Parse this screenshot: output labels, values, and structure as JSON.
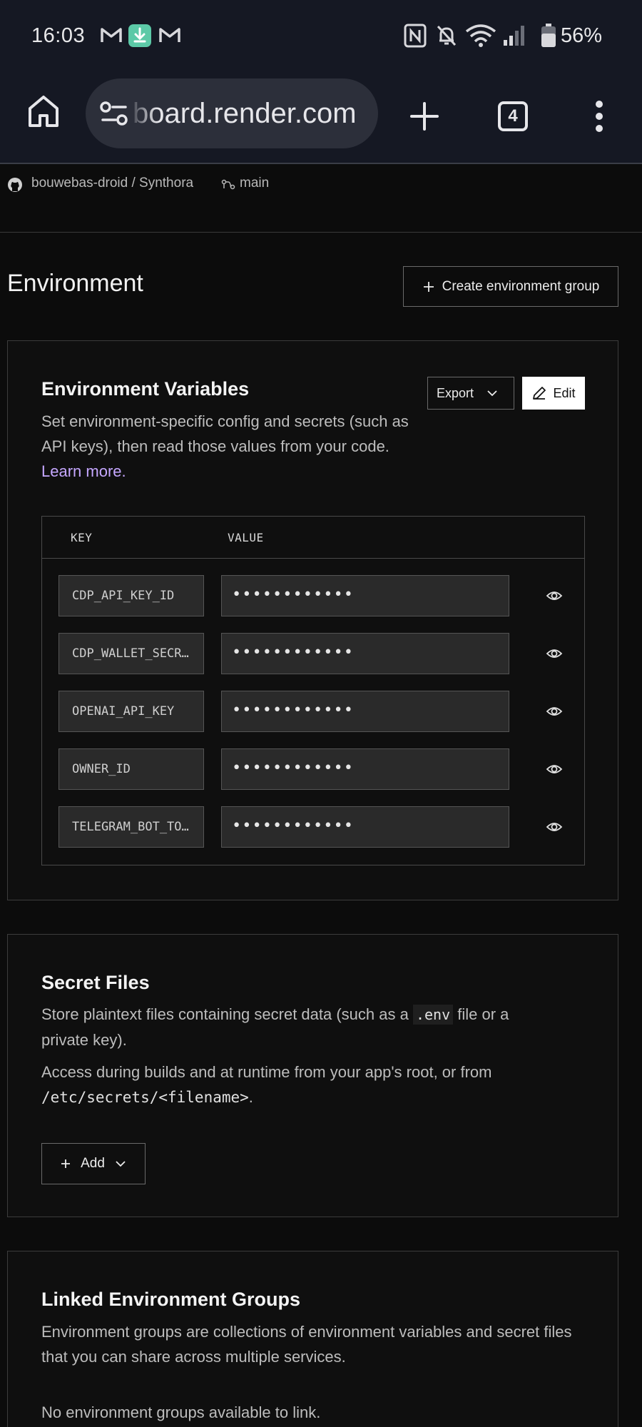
{
  "status_bar": {
    "time": "16:03",
    "battery": "56%",
    "icons": [
      "gmail-icon",
      "download-icon",
      "gmail-icon",
      "nfc-icon",
      "bell-muted-icon",
      "wifi-icon",
      "signal-icon",
      "battery-icon"
    ]
  },
  "browser": {
    "url": "board.render.com",
    "tab_count": "4",
    "icons": [
      "home-icon",
      "site-settings-icon",
      "new-tab-icon",
      "more-icon"
    ]
  },
  "repo": {
    "name": "bouwebas-droid / Synthora",
    "branch": "main"
  },
  "page": {
    "title": "Environment",
    "create_group_label": "Create environment group"
  },
  "env_vars": {
    "title": "Environment Variables",
    "desc_before": "Set environment-specific config and secrets (such as API keys), then read those values from your code. ",
    "learn_more": "Learn more.",
    "export_label": "Export",
    "edit_label": "Edit",
    "col_key": "KEY",
    "col_value": "VALUE",
    "rows": [
      {
        "key": "CDP_API_KEY_ID",
        "value": "••••••••••••"
      },
      {
        "key": "CDP_WALLET_SECRET",
        "value": "••••••••••••"
      },
      {
        "key": "OPENAI_API_KEY",
        "value": "••••••••••••"
      },
      {
        "key": "OWNER_ID",
        "value": "••••••••••••"
      },
      {
        "key": "TELEGRAM_BOT_TOKEN",
        "value": "••••••••••••"
      }
    ]
  },
  "secret_files": {
    "title": "Secret Files",
    "desc1_before": "Store plaintext files containing secret data (such as a ",
    "desc1_code": ".env",
    "desc1_after": " file or a private key).",
    "desc2_before": "Access during builds and at runtime from your app's root, or from ",
    "desc2_code": "/etc/secrets/<filename>",
    "desc2_after": ".",
    "add_label": "Add"
  },
  "linked_groups": {
    "title": "Linked Environment Groups",
    "desc": "Environment groups are collections of environment variables and secret files that you can share across multiple services.",
    "empty": "No environment groups available to link."
  }
}
